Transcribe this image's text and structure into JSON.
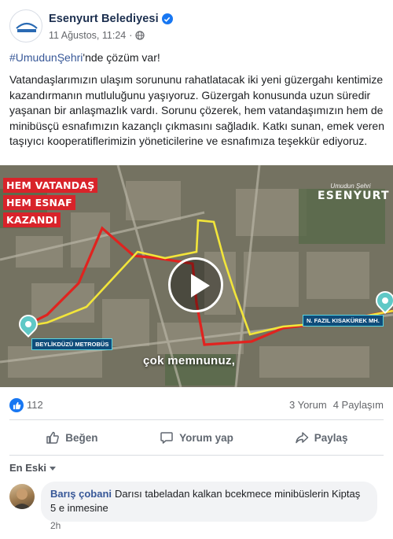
{
  "post": {
    "page_name": "Esenyurt Belediyesi",
    "timestamp": "11 Ağustos, 11:24",
    "separator": "·",
    "hashtag": "#UmudunŞehri",
    "first_line_rest": "'nde çözüm var!",
    "body": "Vatandaşlarımızın ulaşım sorununu rahatlatacak iki yeni güzergahı kentimize kazandırmanın mutluluğunu yaşıyoruz. Güzergah konusunda uzun süredir yaşanan bir anlaşmazlık vardı. Sorunu çözerek, hem vatandaşımızın hem de minibüsçü esnafımızın kazançlı çıkmasını sağladık. Katkı sunan, emek veren taşıyıcı kooperatiflerimizin yöneticilerine ve esnafımıza teşekkür ediyoruz."
  },
  "video": {
    "banner_lines": [
      "HEM VATANDAŞ",
      "HEM ESNAF",
      "KAZANDI"
    ],
    "brand_top": "Umudun Şehri",
    "brand_main": "ESENYURT",
    "label_left": "BEYLİKDÜZÜ METROBÜS",
    "label_right": "N. FAZIL KISAKÜREK MH.",
    "subtitle": "çok memnunuz,"
  },
  "stats": {
    "like_count": "112",
    "comments": "3 Yorum",
    "shares": "4 Paylaşım"
  },
  "actions": {
    "like": "Beğen",
    "comment": "Yorum yap",
    "share": "Paylaş"
  },
  "comments": {
    "sort_label": "En Eski",
    "items": [
      {
        "author": "Barış çobani",
        "text": "Darısı tabeladan kalkan bcekmece minibüslerin Kiptaş 5 e inmesine",
        "time": "2h"
      }
    ]
  },
  "colors": {
    "brand_blue": "#1877f2",
    "link_blue": "#385898",
    "route_red": "#e0231f",
    "route_yellow": "#f2e53a"
  }
}
